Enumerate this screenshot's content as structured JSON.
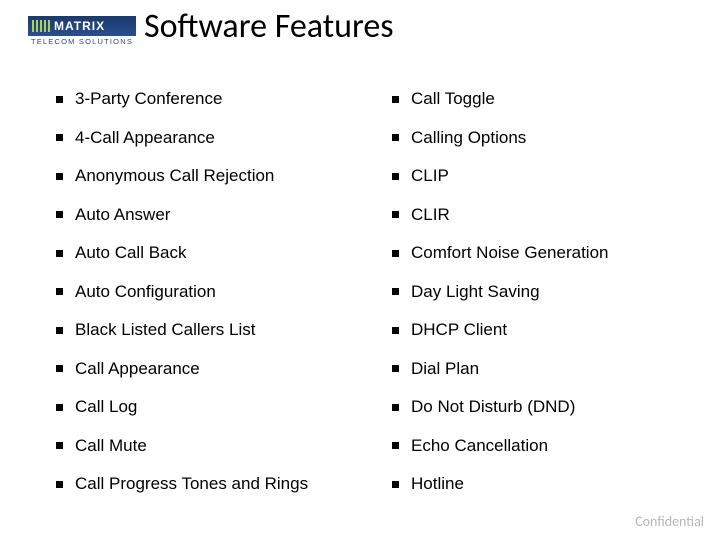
{
  "logo": {
    "name": "MATRIX",
    "tagline": "TELECOM SOLUTIONS"
  },
  "title": "Software Features",
  "features": {
    "left": [
      "3-Party Conference",
      "4-Call Appearance",
      "Anonymous Call Rejection",
      "Auto Answer",
      "Auto Call Back",
      "Auto Configuration",
      "Black Listed Callers List",
      "Call Appearance",
      "Call Log",
      "Call Mute",
      "Call Progress Tones and Rings"
    ],
    "right": [
      "Call Toggle",
      "Calling Options",
      "CLIP",
      "CLIR",
      "Comfort Noise Generation",
      "Day Light Saving",
      "DHCP Client",
      "Dial Plan",
      "Do Not Disturb (DND)",
      "Echo Cancellation",
      "Hotline"
    ]
  },
  "footer": {
    "confidential": "Confidential"
  }
}
